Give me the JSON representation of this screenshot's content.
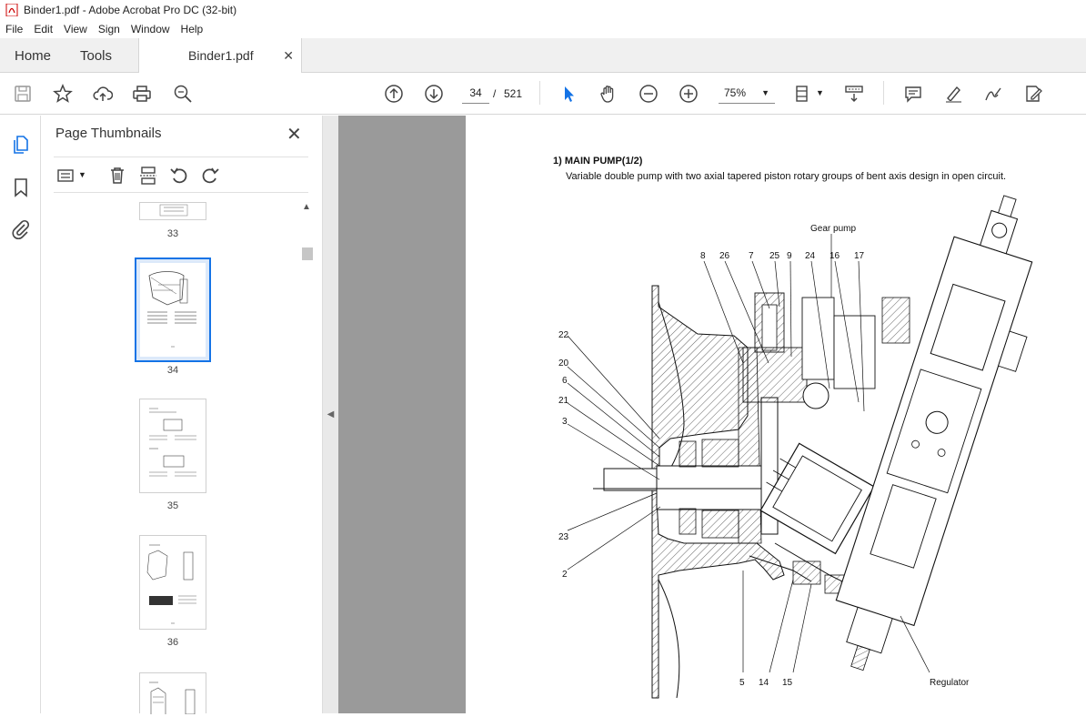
{
  "window": {
    "title": "Binder1.pdf - Adobe Acrobat Pro DC (32-bit)"
  },
  "menu": [
    "File",
    "Edit",
    "View",
    "Sign",
    "Window",
    "Help"
  ],
  "tabs": {
    "home": "Home",
    "tools": "Tools",
    "document": "Binder1.pdf"
  },
  "toolbar": {
    "current_page": "34",
    "separator": "/",
    "total_pages": "521",
    "zoom": "75%"
  },
  "thumbnails": {
    "title": "Page Thumbnails",
    "pages": [
      {
        "number": "33"
      },
      {
        "number": "34",
        "selected": true
      },
      {
        "number": "35"
      },
      {
        "number": "36"
      },
      {
        "number": ""
      }
    ]
  },
  "document": {
    "heading": "1)  MAIN PUMP(1/2)",
    "description": "Variable double pump with two axial tapered piston rotary groups of bent axis design in open circuit.",
    "labels": {
      "gear_pump": "Gear pump",
      "regulator": "Regulator",
      "l8": "8",
      "l26": "26",
      "l7": "7",
      "l25": "25",
      "l9": "9",
      "l24": "24",
      "l16": "16",
      "l17": "17",
      "l22": "22",
      "l20": "20",
      "l6": "6",
      "l21": "21",
      "l3": "3",
      "l23": "23",
      "l2": "2",
      "l5": "5",
      "l14": "14",
      "l15": "15"
    }
  },
  "colors": {
    "accent": "#1473e6",
    "panel_bg": "#f0f0f0",
    "doc_bg": "#9a9a9a"
  }
}
